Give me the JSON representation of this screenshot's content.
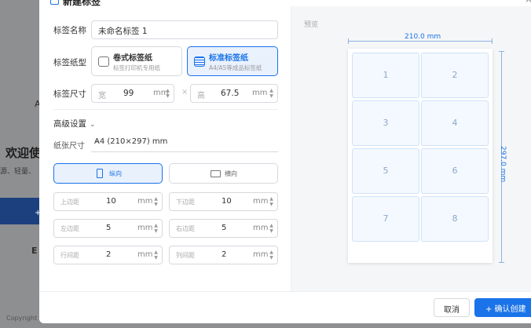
{
  "background": {
    "welcome_title": "欢迎使",
    "welcome_sub": "源、轻量、",
    "letter_a": "A",
    "plus": "+",
    "letter_e": "E",
    "copyright": "Copyright"
  },
  "modal": {
    "title": "新建标签",
    "close": "×",
    "name_label": "标签名称",
    "name_value": "未命名标签 1",
    "type_label": "标签纸型",
    "type_options": [
      {
        "title": "卷式标签纸",
        "sub": "标签打印机专用纸",
        "active": false
      },
      {
        "title": "标准标签纸",
        "sub": "A4/A5等成品标签纸",
        "active": true
      }
    ],
    "size_label": "标签尺寸",
    "width": {
      "prefix": "宽",
      "value": "99",
      "unit": "mm"
    },
    "times": "×",
    "height": {
      "prefix": "高",
      "value": "67.5",
      "unit": "mm"
    },
    "advanced_label": "高级设置",
    "paper_label": "纸张尺寸",
    "paper_value": "A4 (210×297) mm",
    "orientation": [
      {
        "label": "纵向",
        "active": true
      },
      {
        "label": "横向",
        "active": false
      }
    ],
    "margins": {
      "top": {
        "prefix": "上边距",
        "value": "10",
        "unit": "mm"
      },
      "bottom": {
        "prefix": "下边距",
        "value": "10",
        "unit": "mm"
      },
      "left": {
        "prefix": "左边距",
        "value": "5",
        "unit": "mm"
      },
      "right": {
        "prefix": "右边距",
        "value": "5",
        "unit": "mm"
      },
      "row_gap": {
        "prefix": "行间距",
        "value": "2",
        "unit": "mm"
      },
      "col_gap": {
        "prefix": "列间距",
        "value": "2",
        "unit": "mm"
      }
    },
    "stepper_up": "▲",
    "stepper_down": "▼",
    "chevron": "⌄"
  },
  "preview": {
    "label": "预览",
    "width_dim": "210.0 mm",
    "height_dim": "297.0 mm",
    "cells": [
      "1",
      "2",
      "3",
      "4",
      "5",
      "6",
      "7",
      "8"
    ]
  },
  "footer": {
    "cancel": "取消",
    "confirm": "+ 确认创建"
  },
  "colors": {
    "accent": "#1a73e8",
    "accent_bg": "#e9f1fd",
    "cell_border": "#d0e2f6"
  }
}
